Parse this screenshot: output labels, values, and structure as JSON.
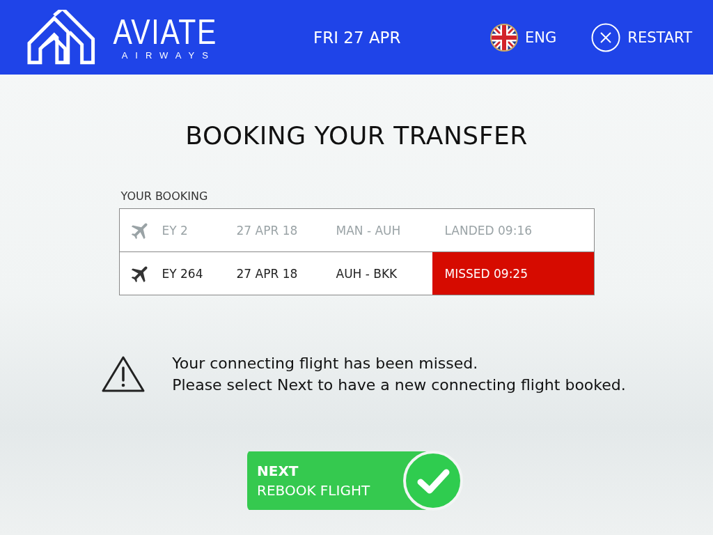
{
  "header": {
    "logo_name": "AVIATE",
    "logo_tagline": "AIRWAYS",
    "date": "FRI 27 APR",
    "language": "ENG",
    "restart": "RESTART"
  },
  "title": "BOOKING YOUR TRANSFER",
  "booking": {
    "label": "YOUR BOOKING",
    "rows": [
      {
        "flight": "EY 2",
        "date": "27 APR 18",
        "route": "MAN - AUH",
        "status": "LANDED 09:16",
        "kind": "landed"
      },
      {
        "flight": "EY 264",
        "date": "27 APR 18",
        "route": "AUH - BKK",
        "status": "MISSED 09:25",
        "kind": "missed"
      }
    ]
  },
  "warning": {
    "lines": [
      "Your connecting flight has been missed.",
      "Please select Next to have a new connecting flight booked."
    ]
  },
  "next_button": {
    "title": "NEXT",
    "subtitle": "REBOOK FLIGHT"
  }
}
